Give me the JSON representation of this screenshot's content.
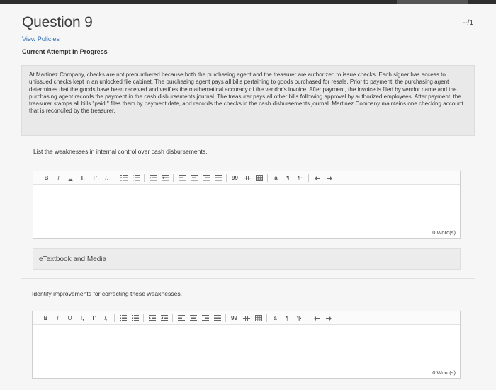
{
  "question": {
    "title": "Question 9",
    "points": "--/1",
    "view_policies": "View Policies",
    "attempt_status": "Current Attempt in Progress",
    "passage": "At Martinez Company, checks are not prenumbered because both the purchasing agent and the treasurer are authorized to issue checks. Each signer has access to unissued checks kept in an unlocked file cabinet. The purchasing agent pays all bills pertaining to goods purchased for resale. Prior to payment, the purchasing agent determines that the goods have been received and verifies the mathematical accuracy of the vendor's invoice. After payment, the invoice is filed by vendor name and the purchasing agent records the payment in the cash disbursements journal. The treasurer pays all other bills following approval by authorized employees. After payment, the treasurer stamps all bills \"paid,\" files them by payment date, and records the checks in the cash disbursements journal. Martinez Company maintains one checking account that is reconciled by the treasurer."
  },
  "part1": {
    "prompt": "List the weaknesses in internal control over cash disbursements.",
    "word_count": "0 Word(s)"
  },
  "etextbook": {
    "label": "eTextbook and Media"
  },
  "part2": {
    "prompt": "Identify improvements for correcting these weaknesses.",
    "word_count": "0 Word(s)"
  },
  "toolbar": {
    "bold": "B",
    "italic": "I",
    "underline": "U",
    "subscript": "T,",
    "superscript": "T'",
    "clear_format": "I,",
    "quote": "99",
    "special_char": "á",
    "ltr": "¶",
    "rtl": "¶·"
  }
}
